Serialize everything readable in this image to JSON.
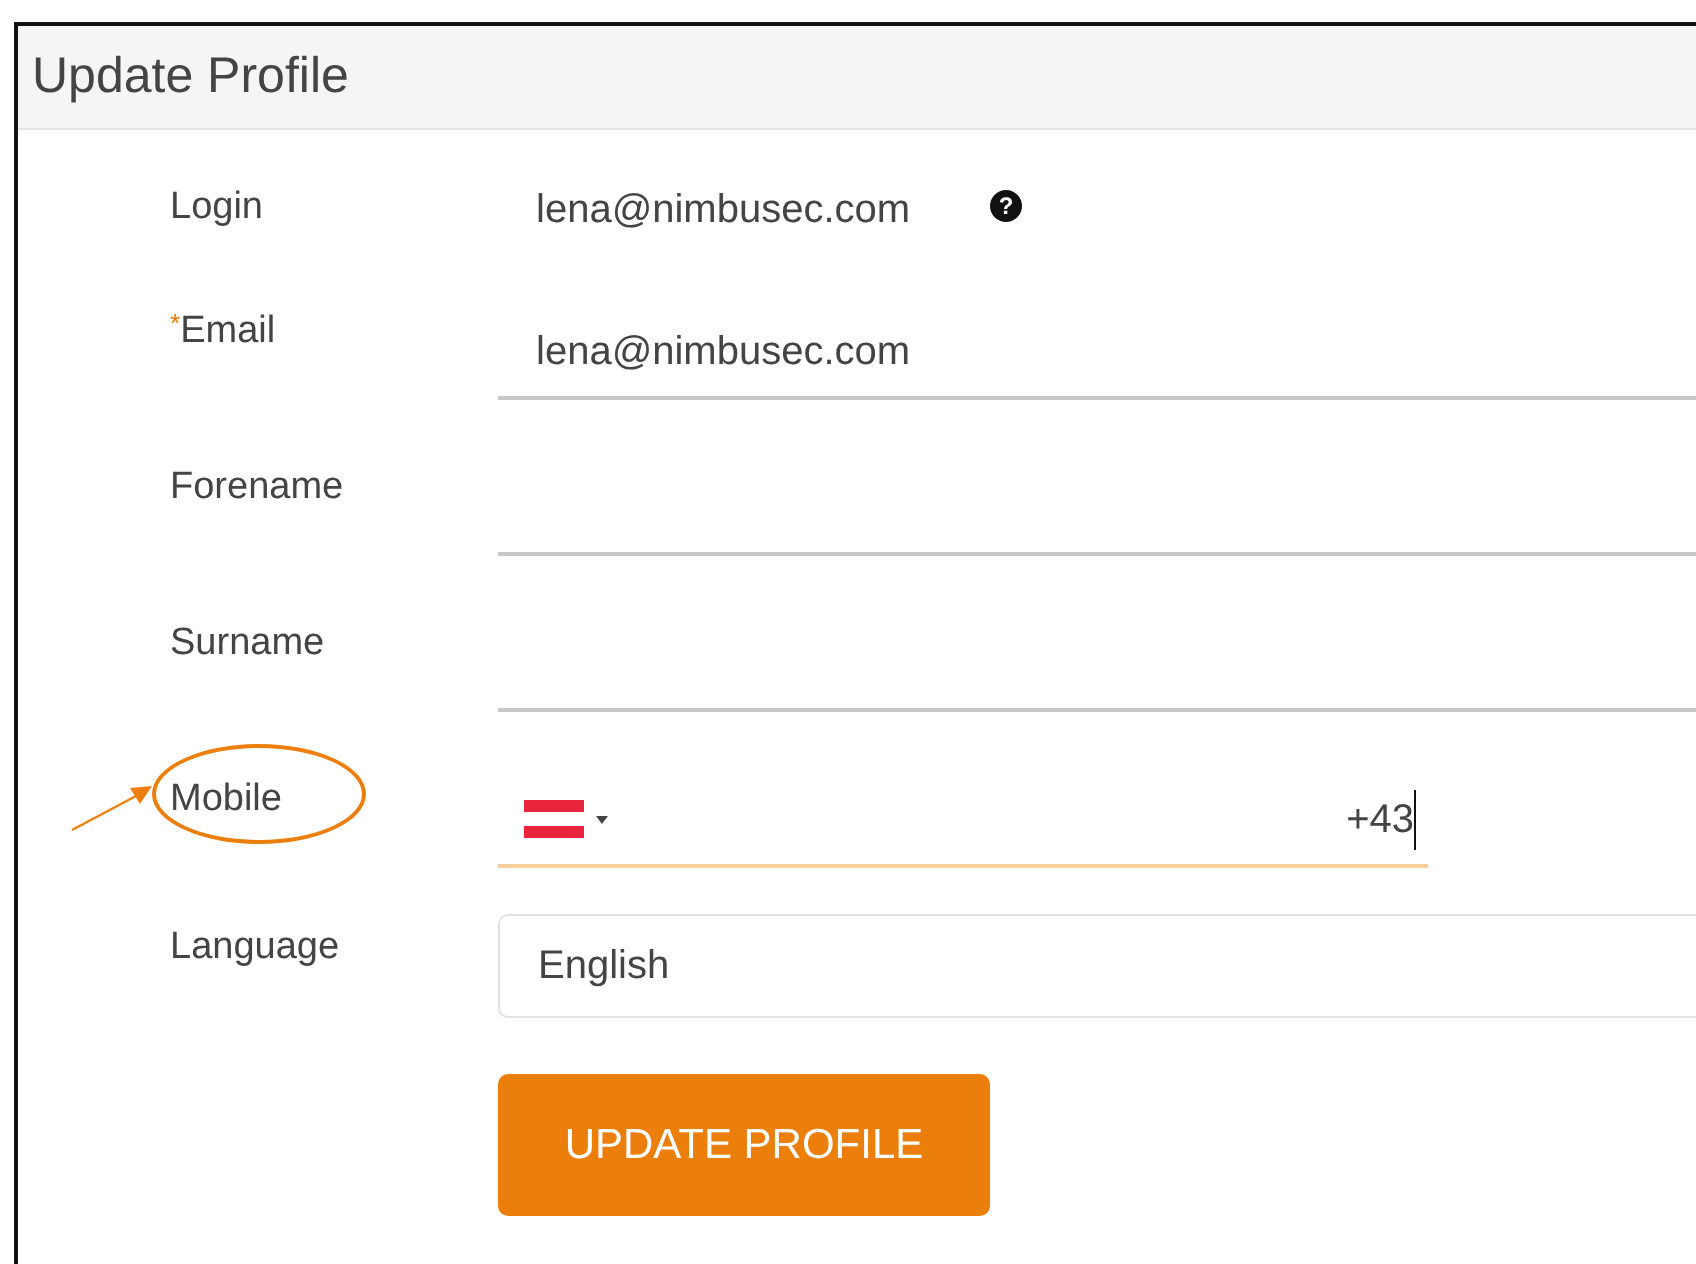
{
  "panel": {
    "title": "Update Profile"
  },
  "fields": [
    {
      "kind": "static",
      "label": "Login",
      "required": false,
      "annotated": false,
      "value": "lena@nimbusec.com",
      "help": "?"
    },
    {
      "kind": "input",
      "label": "Email",
      "required": true,
      "annotated": false,
      "value": "lena@nimbusec.com"
    },
    {
      "kind": "input",
      "label": "Forename",
      "required": false,
      "annotated": false
    },
    {
      "kind": "input",
      "label": "Surname",
      "required": false,
      "annotated": false
    },
    {
      "kind": "phone",
      "label": "Mobile",
      "required": false,
      "annotated": true,
      "value": "+43",
      "focused": true
    },
    {
      "kind": "select",
      "label": "Language",
      "required": false,
      "annotated": false,
      "value": "English"
    }
  ],
  "required_mark": "*",
  "submit": {
    "label": "UPDATE PROFILE"
  }
}
